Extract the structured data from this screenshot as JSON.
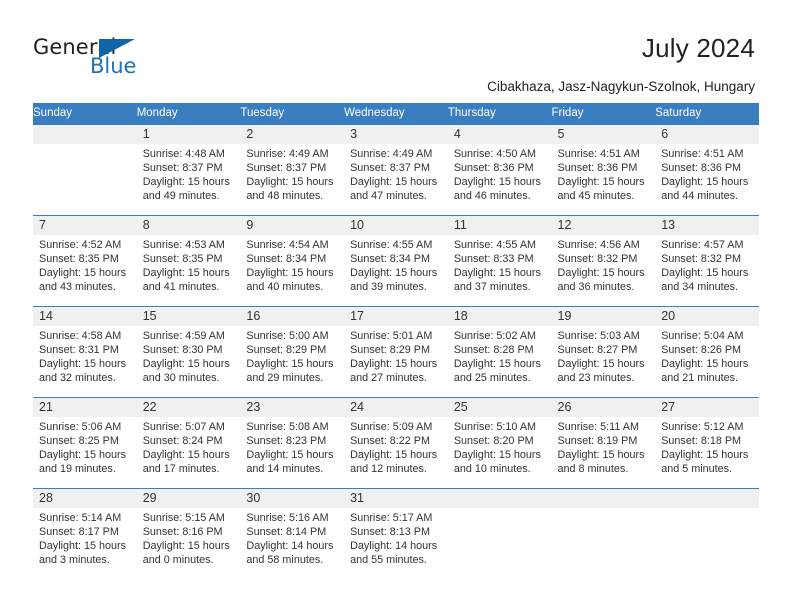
{
  "brand": {
    "name_dark": "General",
    "name_blue": "Blue",
    "accent_color": "#1d72b8",
    "triangle_color": "#1064a8"
  },
  "header": {
    "title": "July 2024",
    "subtitle": "Cibakhaza, Jasz-Nagykun-Szolnok, Hungary"
  },
  "calendar": {
    "header_bg": "#3a7ebf",
    "daynum_bg": "#f0f0f0",
    "weekday_names": [
      "Sunday",
      "Monday",
      "Tuesday",
      "Wednesday",
      "Thursday",
      "Friday",
      "Saturday"
    ],
    "weeks": [
      [
        {
          "day": "",
          "sunrise": "",
          "sunset": "",
          "daylight": ""
        },
        {
          "day": "1",
          "sunrise": "Sunrise: 4:48 AM",
          "sunset": "Sunset: 8:37 PM",
          "daylight": "Daylight: 15 hours and 49 minutes."
        },
        {
          "day": "2",
          "sunrise": "Sunrise: 4:49 AM",
          "sunset": "Sunset: 8:37 PM",
          "daylight": "Daylight: 15 hours and 48 minutes."
        },
        {
          "day": "3",
          "sunrise": "Sunrise: 4:49 AM",
          "sunset": "Sunset: 8:37 PM",
          "daylight": "Daylight: 15 hours and 47 minutes."
        },
        {
          "day": "4",
          "sunrise": "Sunrise: 4:50 AM",
          "sunset": "Sunset: 8:36 PM",
          "daylight": "Daylight: 15 hours and 46 minutes."
        },
        {
          "day": "5",
          "sunrise": "Sunrise: 4:51 AM",
          "sunset": "Sunset: 8:36 PM",
          "daylight": "Daylight: 15 hours and 45 minutes."
        },
        {
          "day": "6",
          "sunrise": "Sunrise: 4:51 AM",
          "sunset": "Sunset: 8:36 PM",
          "daylight": "Daylight: 15 hours and 44 minutes."
        }
      ],
      [
        {
          "day": "7",
          "sunrise": "Sunrise: 4:52 AM",
          "sunset": "Sunset: 8:35 PM",
          "daylight": "Daylight: 15 hours and 43 minutes."
        },
        {
          "day": "8",
          "sunrise": "Sunrise: 4:53 AM",
          "sunset": "Sunset: 8:35 PM",
          "daylight": "Daylight: 15 hours and 41 minutes."
        },
        {
          "day": "9",
          "sunrise": "Sunrise: 4:54 AM",
          "sunset": "Sunset: 8:34 PM",
          "daylight": "Daylight: 15 hours and 40 minutes."
        },
        {
          "day": "10",
          "sunrise": "Sunrise: 4:55 AM",
          "sunset": "Sunset: 8:34 PM",
          "daylight": "Daylight: 15 hours and 39 minutes."
        },
        {
          "day": "11",
          "sunrise": "Sunrise: 4:55 AM",
          "sunset": "Sunset: 8:33 PM",
          "daylight": "Daylight: 15 hours and 37 minutes."
        },
        {
          "day": "12",
          "sunrise": "Sunrise: 4:56 AM",
          "sunset": "Sunset: 8:32 PM",
          "daylight": "Daylight: 15 hours and 36 minutes."
        },
        {
          "day": "13",
          "sunrise": "Sunrise: 4:57 AM",
          "sunset": "Sunset: 8:32 PM",
          "daylight": "Daylight: 15 hours and 34 minutes."
        }
      ],
      [
        {
          "day": "14",
          "sunrise": "Sunrise: 4:58 AM",
          "sunset": "Sunset: 8:31 PM",
          "daylight": "Daylight: 15 hours and 32 minutes."
        },
        {
          "day": "15",
          "sunrise": "Sunrise: 4:59 AM",
          "sunset": "Sunset: 8:30 PM",
          "daylight": "Daylight: 15 hours and 30 minutes."
        },
        {
          "day": "16",
          "sunrise": "Sunrise: 5:00 AM",
          "sunset": "Sunset: 8:29 PM",
          "daylight": "Daylight: 15 hours and 29 minutes."
        },
        {
          "day": "17",
          "sunrise": "Sunrise: 5:01 AM",
          "sunset": "Sunset: 8:29 PM",
          "daylight": "Daylight: 15 hours and 27 minutes."
        },
        {
          "day": "18",
          "sunrise": "Sunrise: 5:02 AM",
          "sunset": "Sunset: 8:28 PM",
          "daylight": "Daylight: 15 hours and 25 minutes."
        },
        {
          "day": "19",
          "sunrise": "Sunrise: 5:03 AM",
          "sunset": "Sunset: 8:27 PM",
          "daylight": "Daylight: 15 hours and 23 minutes."
        },
        {
          "day": "20",
          "sunrise": "Sunrise: 5:04 AM",
          "sunset": "Sunset: 8:26 PM",
          "daylight": "Daylight: 15 hours and 21 minutes."
        }
      ],
      [
        {
          "day": "21",
          "sunrise": "Sunrise: 5:06 AM",
          "sunset": "Sunset: 8:25 PM",
          "daylight": "Daylight: 15 hours and 19 minutes."
        },
        {
          "day": "22",
          "sunrise": "Sunrise: 5:07 AM",
          "sunset": "Sunset: 8:24 PM",
          "daylight": "Daylight: 15 hours and 17 minutes."
        },
        {
          "day": "23",
          "sunrise": "Sunrise: 5:08 AM",
          "sunset": "Sunset: 8:23 PM",
          "daylight": "Daylight: 15 hours and 14 minutes."
        },
        {
          "day": "24",
          "sunrise": "Sunrise: 5:09 AM",
          "sunset": "Sunset: 8:22 PM",
          "daylight": "Daylight: 15 hours and 12 minutes."
        },
        {
          "day": "25",
          "sunrise": "Sunrise: 5:10 AM",
          "sunset": "Sunset: 8:20 PM",
          "daylight": "Daylight: 15 hours and 10 minutes."
        },
        {
          "day": "26",
          "sunrise": "Sunrise: 5:11 AM",
          "sunset": "Sunset: 8:19 PM",
          "daylight": "Daylight: 15 hours and 8 minutes."
        },
        {
          "day": "27",
          "sunrise": "Sunrise: 5:12 AM",
          "sunset": "Sunset: 8:18 PM",
          "daylight": "Daylight: 15 hours and 5 minutes."
        }
      ],
      [
        {
          "day": "28",
          "sunrise": "Sunrise: 5:14 AM",
          "sunset": "Sunset: 8:17 PM",
          "daylight": "Daylight: 15 hours and 3 minutes."
        },
        {
          "day": "29",
          "sunrise": "Sunrise: 5:15 AM",
          "sunset": "Sunset: 8:16 PM",
          "daylight": "Daylight: 15 hours and 0 minutes."
        },
        {
          "day": "30",
          "sunrise": "Sunrise: 5:16 AM",
          "sunset": "Sunset: 8:14 PM",
          "daylight": "Daylight: 14 hours and 58 minutes."
        },
        {
          "day": "31",
          "sunrise": "Sunrise: 5:17 AM",
          "sunset": "Sunset: 8:13 PM",
          "daylight": "Daylight: 14 hours and 55 minutes."
        },
        {
          "day": "",
          "sunrise": "",
          "sunset": "",
          "daylight": ""
        },
        {
          "day": "",
          "sunrise": "",
          "sunset": "",
          "daylight": ""
        },
        {
          "day": "",
          "sunrise": "",
          "sunset": "",
          "daylight": ""
        }
      ]
    ]
  }
}
